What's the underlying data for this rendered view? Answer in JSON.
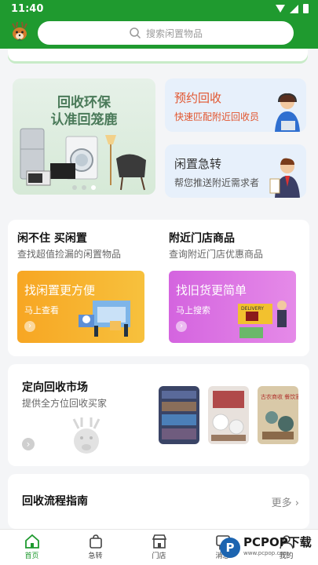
{
  "status_bar": {
    "time": "11:40"
  },
  "header": {
    "search_placeholder": "搜索闲置物品"
  },
  "promo_big": {
    "line1": "回收环保",
    "line2": "认准回笼鹿"
  },
  "promo_cards": [
    {
      "title": "预约回收",
      "subtitle": "快速匹配附近回收员",
      "title_color": "#e2552e",
      "sub_color": "#e2552e"
    },
    {
      "title": "闲置急转",
      "subtitle": "帮您推送附近需求者",
      "title_color": "#333333",
      "sub_color": "#555555"
    }
  ],
  "section_a": {
    "title": "闲不住 买闲置",
    "subtitle": "查找超值捡漏的闲置物品",
    "tile_title": "找闲置更方便",
    "tile_sub": "马上查看"
  },
  "section_b": {
    "title": "附近门店商品",
    "subtitle": "查询附近门店优惠商品",
    "tile_title": "找旧货更简单",
    "tile_sub": "马上搜索",
    "delivery_label": "DELIVERY"
  },
  "market": {
    "title": "定向回收市场",
    "subtitle": "提供全方位回收买家",
    "poster_text": "古农商收 餐饮家"
  },
  "guide": {
    "title": "回收流程指南",
    "more": "更多"
  },
  "tabs": [
    {
      "label": "首页",
      "icon": "home-icon"
    },
    {
      "label": "急转",
      "icon": "bag-icon"
    },
    {
      "label": "门店",
      "icon": "store-icon"
    },
    {
      "label": "消息",
      "icon": "message-icon"
    },
    {
      "label": "我的",
      "icon": "user-icon"
    }
  ],
  "watermark": {
    "badge": "P",
    "text": "PCPOP下载",
    "small": "www.pcpop.com"
  },
  "colors": {
    "brand_green": "#1f9a2f",
    "tile_orange": "#f6a623",
    "tile_purple": "#d86ae0"
  }
}
